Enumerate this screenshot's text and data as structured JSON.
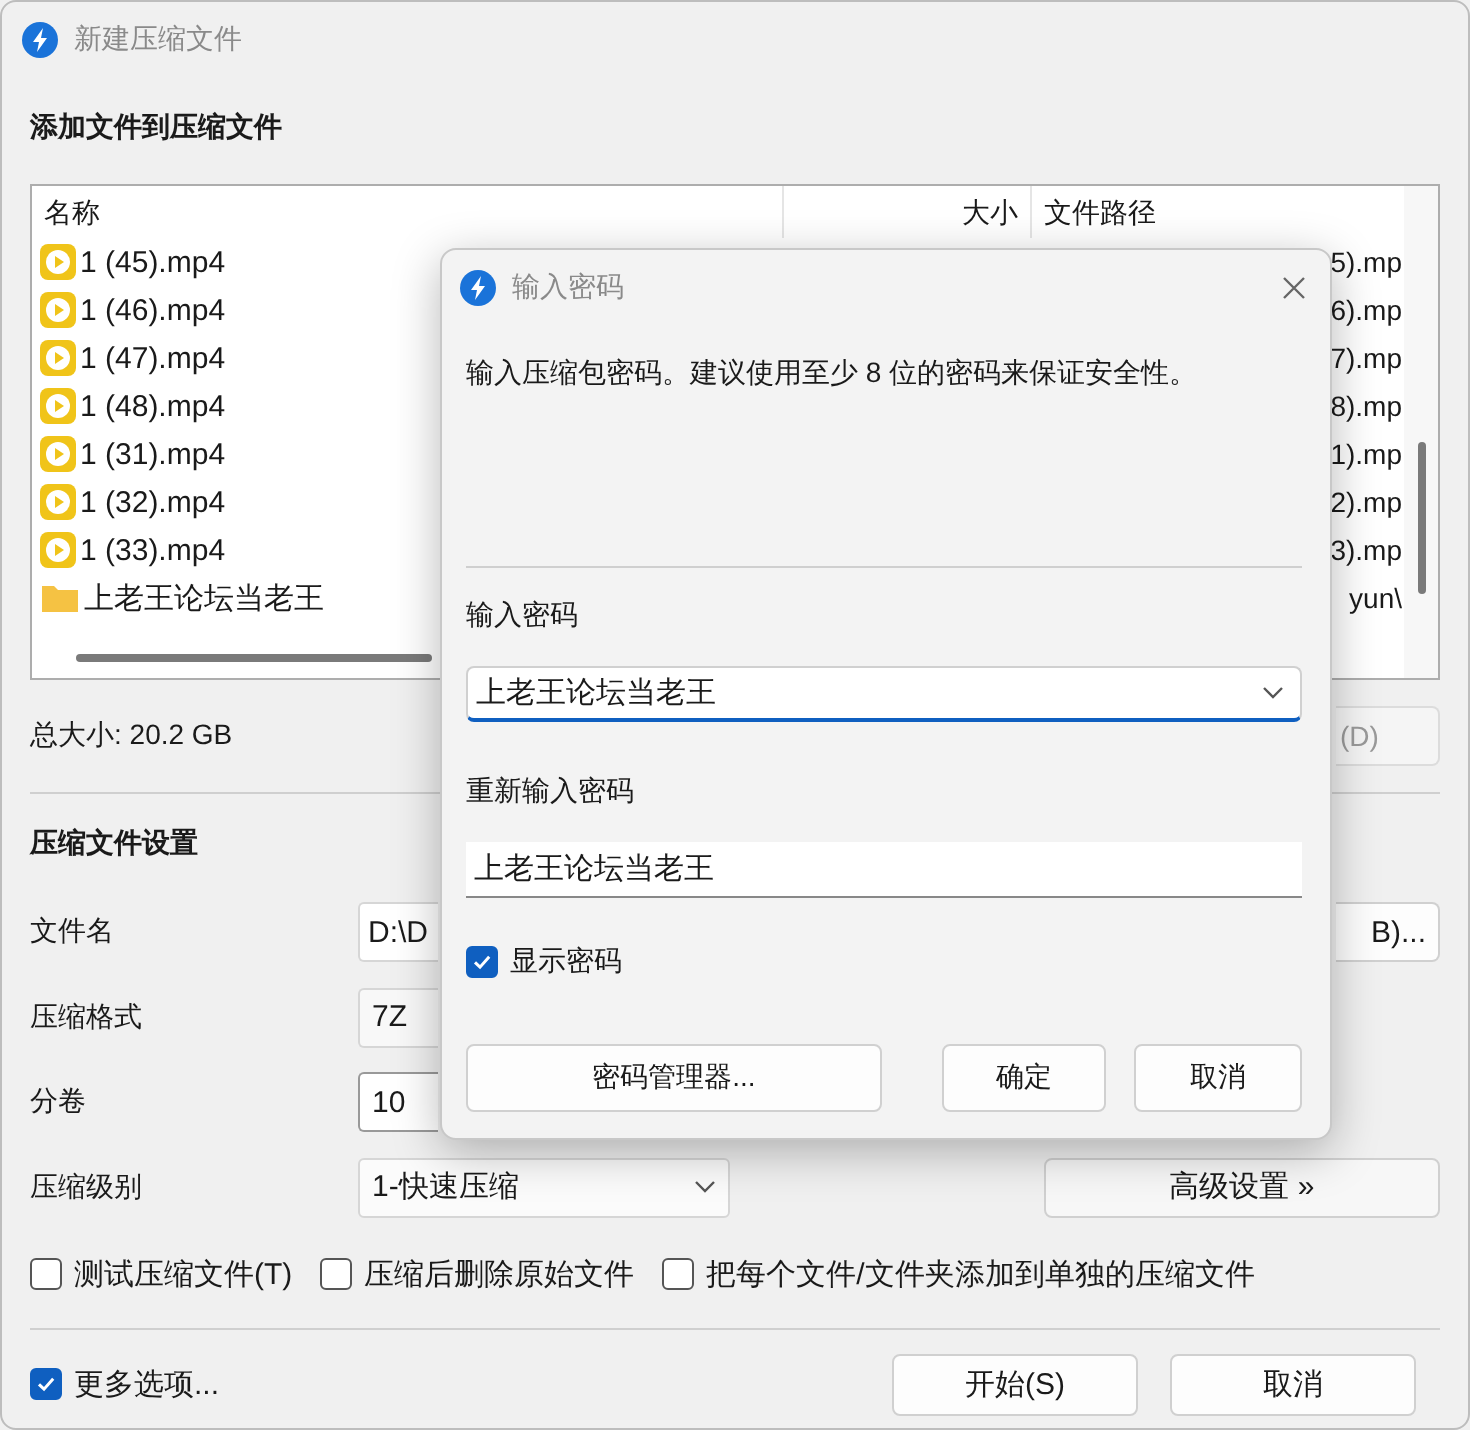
{
  "window": {
    "title": "新建压缩文件"
  },
  "files_section": {
    "heading": "添加文件到压缩文件",
    "columns": [
      {
        "label": "名称"
      },
      {
        "label": "大小"
      },
      {
        "label": "文件路径"
      }
    ],
    "rows": [
      {
        "kind": "video",
        "name": "1 (45).mp4",
        "path": "5).mp"
      },
      {
        "kind": "video",
        "name": "1 (46).mp4",
        "path": "6).mp"
      },
      {
        "kind": "video",
        "name": "1 (47).mp4",
        "path": "7).mp"
      },
      {
        "kind": "video",
        "name": "1 (48).mp4",
        "path": "8).mp"
      },
      {
        "kind": "video",
        "name": "1 (31).mp4",
        "path": "1).mp"
      },
      {
        "kind": "video",
        "name": "1 (32).mp4",
        "path": "2).mp"
      },
      {
        "kind": "video",
        "name": "1 (33).mp4",
        "path": "3).mp"
      },
      {
        "kind": "folder",
        "name": "上老王论坛当老王",
        "path": "yun\\"
      }
    ],
    "total_size": "总大小: 20.2 GB",
    "side_button": "(D)"
  },
  "settings": {
    "heading": "压缩文件设置",
    "filename": {
      "label": "文件名",
      "value": "D:\\D",
      "button": "B)..."
    },
    "format": {
      "label": "压缩格式",
      "value": "7Z"
    },
    "volume": {
      "label": "分卷",
      "value": "10"
    },
    "level": {
      "label": "压缩级别",
      "value": "1-快速压缩",
      "button": "高级设置 »"
    },
    "options": [
      {
        "label": "测试压缩文件(T)",
        "checked": false
      },
      {
        "label": "压缩后删除原始文件",
        "checked": false
      },
      {
        "label": "把每个文件/文件夹添加到单独的压缩文件",
        "checked": false
      }
    ]
  },
  "footer": {
    "more_options": {
      "label": "更多选项...",
      "checked": true
    },
    "buttons": [
      "开始(S)",
      "取消"
    ]
  },
  "password_dialog": {
    "title": "输入密码",
    "description": "输入压缩包密码。建议使用至少 8 位的密码来保证安全性。",
    "password_label": "输入密码",
    "password_value": "上老王论坛当老王",
    "confirm_label": "重新输入密码",
    "confirm_value": "上老王论坛当老王",
    "show_password": {
      "label": "显示密码",
      "checked": true
    },
    "buttons": [
      {
        "kind": "manager",
        "label": "密码管理器..."
      },
      {
        "kind": "ok",
        "label": "确定"
      },
      {
        "kind": "cancel",
        "label": "取消"
      }
    ]
  }
}
